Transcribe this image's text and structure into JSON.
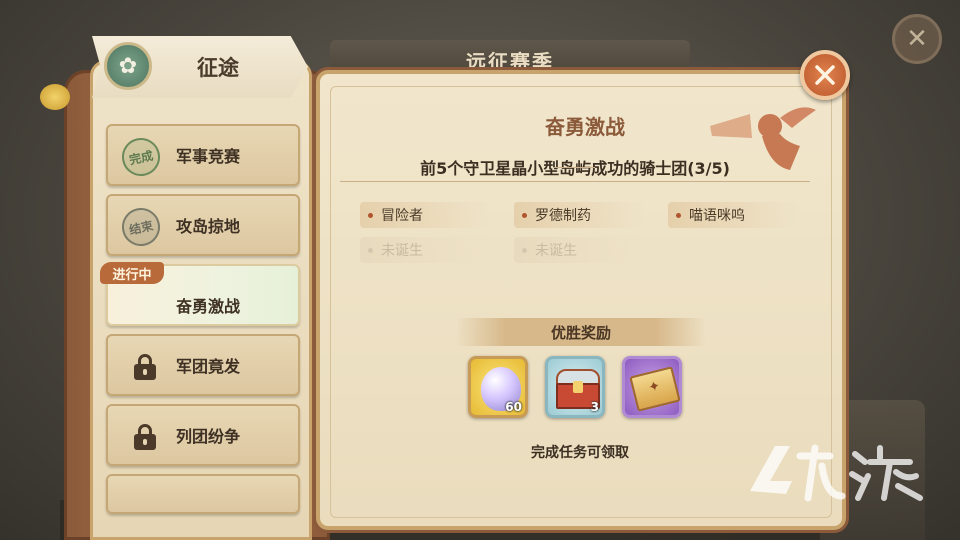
{
  "background": {
    "season_title": "远征赛季"
  },
  "sidebar": {
    "header_title": "征途",
    "progress_badge": "进行中",
    "items": [
      {
        "label": "军事竞赛",
        "stamp": "完成",
        "state": "done"
      },
      {
        "label": "攻岛掠地",
        "stamp": "结束",
        "state": "ended"
      },
      {
        "label": "奋勇激战",
        "stamp": "",
        "state": "active"
      },
      {
        "label": "军团竟发",
        "stamp": "",
        "state": "locked"
      },
      {
        "label": "列团纷争",
        "stamp": "",
        "state": "locked"
      }
    ]
  },
  "main": {
    "title": "奋勇激战",
    "goal": "前5个守卫星晶小型岛屿成功的骑士团(3/5)",
    "guilds": [
      {
        "name": "冒险者",
        "filled": true
      },
      {
        "name": "罗德制药",
        "filled": true
      },
      {
        "name": "喵语咪呜",
        "filled": true
      },
      {
        "name": "未诞生",
        "filled": false
      },
      {
        "name": "未诞生",
        "filled": false
      }
    ],
    "reward_header": "优胜奖励",
    "rewards": [
      {
        "icon": "crystal-gem-icon",
        "count": "60"
      },
      {
        "icon": "treasure-chest-icon",
        "count": "3"
      },
      {
        "icon": "scroll-ticket-icon",
        "count": ""
      }
    ],
    "claim_text": "完成任务可领取"
  },
  "colors": {
    "accent": "#8b5a3a",
    "close_button": "#d06a3a",
    "badge": "#b86a3a"
  }
}
